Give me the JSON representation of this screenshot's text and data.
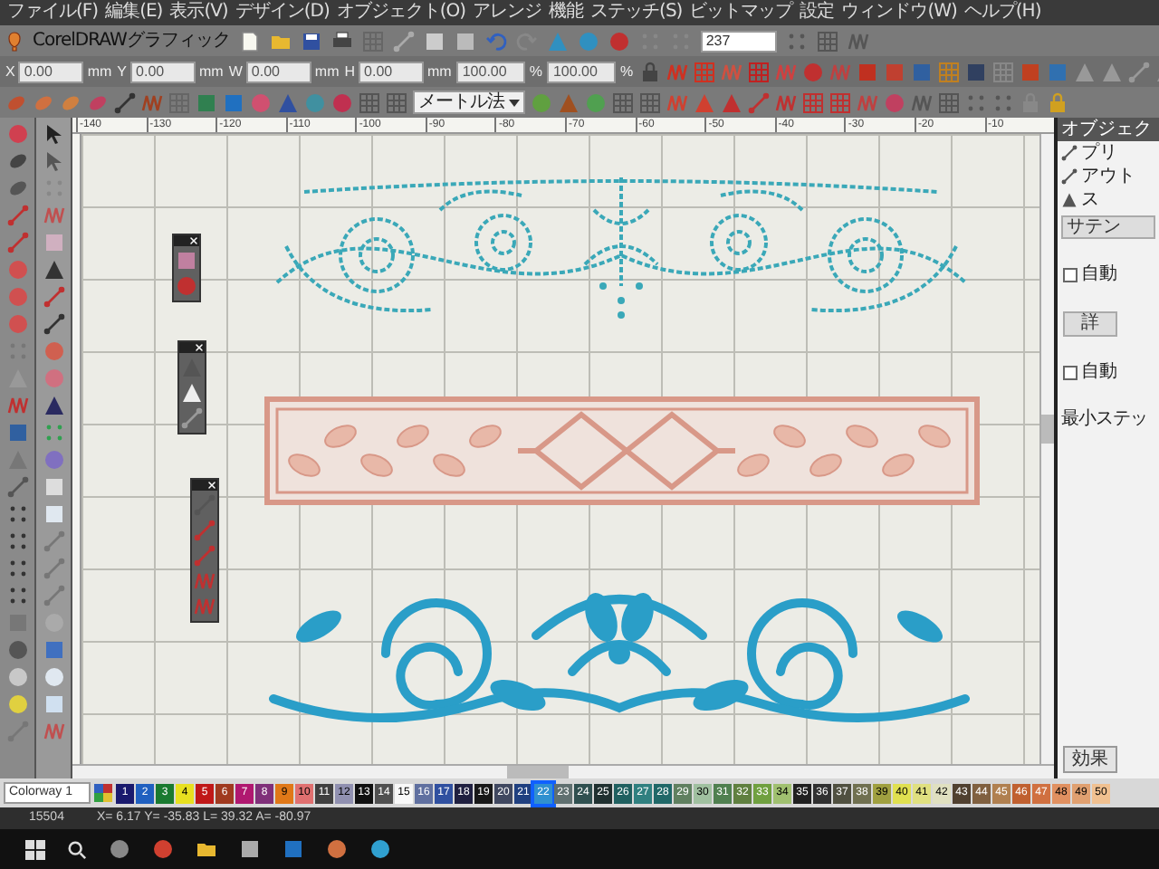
{
  "menu": [
    {
      "label": "ファイル(F)"
    },
    {
      "label": "編集(E)"
    },
    {
      "label": "表示(V)"
    },
    {
      "label": "デザイン(D)"
    },
    {
      "label": "オブジェクト(O)"
    },
    {
      "label": "アレンジ"
    },
    {
      "label": "機能"
    },
    {
      "label": "ステッチ(S)"
    },
    {
      "label": "ビットマップ"
    },
    {
      "label": "設定"
    },
    {
      "label": "ウィンドウ(W)"
    },
    {
      "label": "ヘルプ(H)"
    }
  ],
  "toolbar": {
    "app_label": "CorelDRAWグラフィック",
    "count_field": "237"
  },
  "transform": [
    {
      "label": "X",
      "value": "0.00",
      "unit": "mm"
    },
    {
      "label": "Y",
      "value": "0.00",
      "unit": "mm"
    },
    {
      "label": "W",
      "value": "0.00",
      "unit": "mm"
    },
    {
      "label": "H",
      "value": "0.00",
      "unit": "mm"
    }
  ],
  "scale": [
    {
      "value": "100.00",
      "unit": "%"
    },
    {
      "value": "100.00",
      "unit": "%"
    }
  ],
  "units_dropdown": "メートル法",
  "ruler": [
    "-140",
    "-130",
    "-120",
    "-110",
    "-100",
    "-90",
    "-80",
    "-70",
    "-60",
    "-50",
    "-40",
    "-30",
    "-20",
    "-10"
  ],
  "object_panel": {
    "title": "オブジェク",
    "items": [
      {
        "label": "プリ"
      },
      {
        "label": "アウト"
      },
      {
        "label": "ス"
      }
    ],
    "stitch_type": "サテン",
    "options": [
      {
        "kind": "checkbox",
        "label": "自動",
        "checked": false
      },
      {
        "kind": "button",
        "label": "詳"
      },
      {
        "kind": "checkbox",
        "label": "自動",
        "checked": false
      }
    ],
    "min_stitch_label": "最小ステッ",
    "effects_button": "効果"
  },
  "palette": {
    "colorway": "Colorway 1",
    "swatches": [
      {
        "label": "1",
        "color": "#1a1a6e",
        "selected": false
      },
      {
        "label": "2",
        "color": "#2060c0",
        "selected": false
      },
      {
        "label": "3",
        "color": "#1a7a30",
        "selected": false
      },
      {
        "label": "4",
        "color": "#e8e020",
        "selected": false
      },
      {
        "label": "5",
        "color": "#c01818",
        "selected": false
      },
      {
        "label": "6",
        "color": "#a03a20",
        "selected": false
      },
      {
        "label": "7",
        "color": "#b01870",
        "selected": false
      },
      {
        "label": "8",
        "color": "#80307a",
        "selected": false
      },
      {
        "label": "9",
        "color": "#e07818",
        "selected": false
      },
      {
        "label": "10",
        "color": "#e07070",
        "selected": false
      },
      {
        "label": "11",
        "color": "#404040",
        "selected": false
      },
      {
        "label": "12",
        "color": "#9090b0",
        "selected": false
      },
      {
        "label": "13",
        "color": "#101010",
        "selected": false
      },
      {
        "label": "14",
        "color": "#505050",
        "selected": false
      },
      {
        "label": "15",
        "color": "#f8f8f8",
        "selected": false
      },
      {
        "label": "16",
        "color": "#6070a0",
        "selected": false
      },
      {
        "label": "17",
        "color": "#3050a0",
        "selected": false
      },
      {
        "label": "18",
        "color": "#202040",
        "selected": false
      },
      {
        "label": "19",
        "color": "#181818",
        "selected": false
      },
      {
        "label": "20",
        "color": "#404860",
        "selected": false
      },
      {
        "label": "21",
        "color": "#204080",
        "selected": false
      },
      {
        "label": "22",
        "color": "#3090d0",
        "selected": true
      },
      {
        "label": "23",
        "color": "#607070",
        "selected": false
      },
      {
        "label": "24",
        "color": "#305050",
        "selected": false
      },
      {
        "label": "25",
        "color": "#203030",
        "selected": false
      },
      {
        "label": "26",
        "color": "#206060",
        "selected": false
      },
      {
        "label": "27",
        "color": "#308080",
        "selected": false
      },
      {
        "label": "28",
        "color": "#206868",
        "selected": false
      },
      {
        "label": "29",
        "color": "#608060",
        "selected": false
      },
      {
        "label": "30",
        "color": "#a0c0a0",
        "selected": false
      },
      {
        "label": "31",
        "color": "#508050",
        "selected": false
      },
      {
        "label": "32",
        "color": "#608040",
        "selected": false
      },
      {
        "label": "33",
        "color": "#70a040",
        "selected": false
      },
      {
        "label": "34",
        "color": "#a0c070",
        "selected": false
      },
      {
        "label": "35",
        "color": "#202020",
        "selected": false
      },
      {
        "label": "36",
        "color": "#303030",
        "selected": false
      },
      {
        "label": "37",
        "color": "#505040",
        "selected": false
      },
      {
        "label": "38",
        "color": "#707050",
        "selected": false
      },
      {
        "label": "39",
        "color": "#a0a040",
        "selected": false
      },
      {
        "label": "40",
        "color": "#e0e050",
        "selected": false
      },
      {
        "label": "41",
        "color": "#e0e080",
        "selected": false
      },
      {
        "label": "42",
        "color": "#e0e0c0",
        "selected": false
      },
      {
        "label": "43",
        "color": "#504030",
        "selected": false
      },
      {
        "label": "44",
        "color": "#806040",
        "selected": false
      },
      {
        "label": "45",
        "color": "#b08050",
        "selected": false
      },
      {
        "label": "46",
        "color": "#c06030",
        "selected": false
      },
      {
        "label": "47",
        "color": "#d07040",
        "selected": false
      },
      {
        "label": "48",
        "color": "#e09060",
        "selected": false
      },
      {
        "label": "49",
        "color": "#e0a070",
        "selected": false
      },
      {
        "label": "50",
        "color": "#f0c090",
        "selected": false
      }
    ]
  },
  "status_bar": {
    "count": "15504",
    "coords": "X= 6.17 Y= -35.83 L= 39.32 A= -80.97"
  }
}
